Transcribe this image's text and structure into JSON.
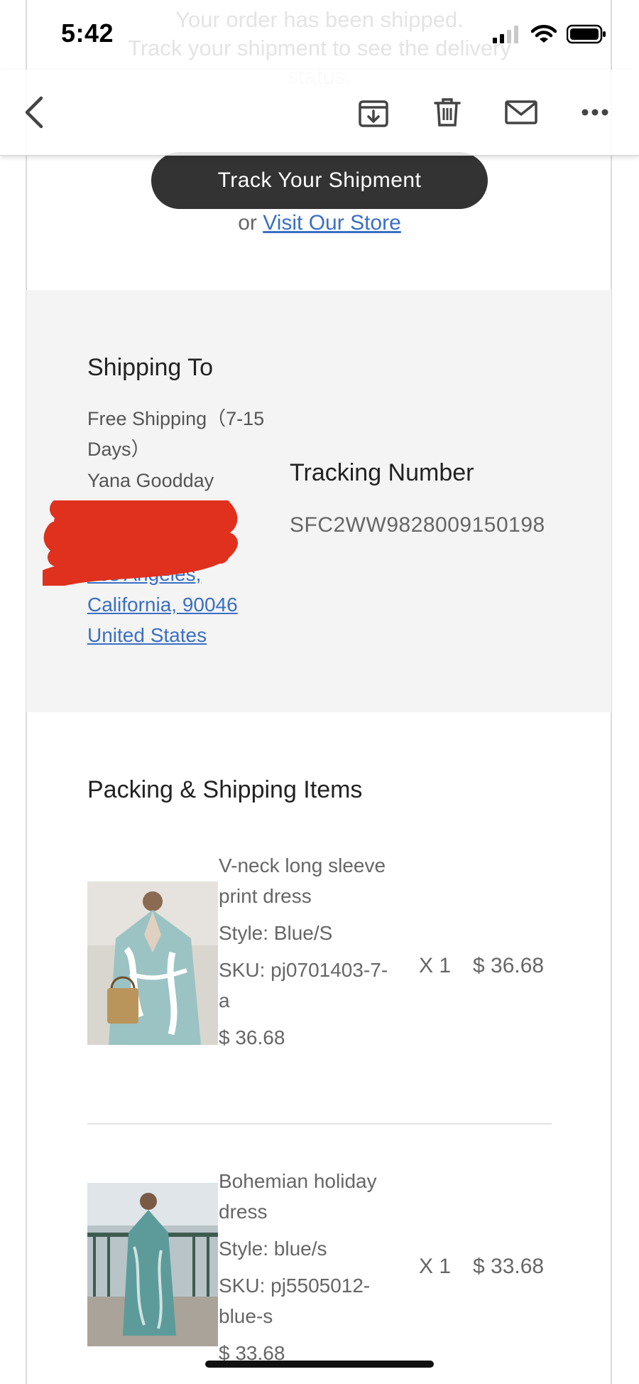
{
  "status_bar": {
    "time": "5:42"
  },
  "background_text": {
    "line1": "Your order has been shipped.",
    "line2": "Track your shipment to see the delivery status."
  },
  "toolbar": {
    "back_icon": "chevron-left-icon",
    "archive_icon": "archive-download-icon",
    "delete_icon": "trash-icon",
    "mail_icon": "envelope-icon",
    "more_icon": "ellipsis-icon"
  },
  "email": {
    "track_button": "Track Your Shipment",
    "or_text": "or",
    "visit_store": "Visit Our Store",
    "shipping": {
      "title": "Shipping To",
      "method": "Free Shipping（7-15 Days）",
      "name": "Yana Goodday",
      "address_lines": [
        "Los Angeles,",
        "California, 90046",
        "United States"
      ]
    },
    "tracking": {
      "title": "Tracking Number",
      "number": "SFC2WW9828009150198"
    },
    "items_title": "Packing & Shipping Items",
    "items": [
      {
        "name": "V-neck long sleeve print dress",
        "style": "Style: Blue/S",
        "sku": "SKU: pj0701403-7-a",
        "unit_price": "$ 36.68",
        "qty": "X 1",
        "total": "$ 36.68"
      },
      {
        "name": "Bohemian holiday dress",
        "style": "Style: blue/s",
        "sku": "SKU: pj5505012-blue-s",
        "unit_price": "$ 33.68",
        "qty": "X 1",
        "total": "$ 33.68"
      }
    ]
  },
  "colors": {
    "link": "#3a6fc4",
    "button_bg": "#333333",
    "panel_bg": "#f4f4f4",
    "redaction": "#e0301e"
  }
}
